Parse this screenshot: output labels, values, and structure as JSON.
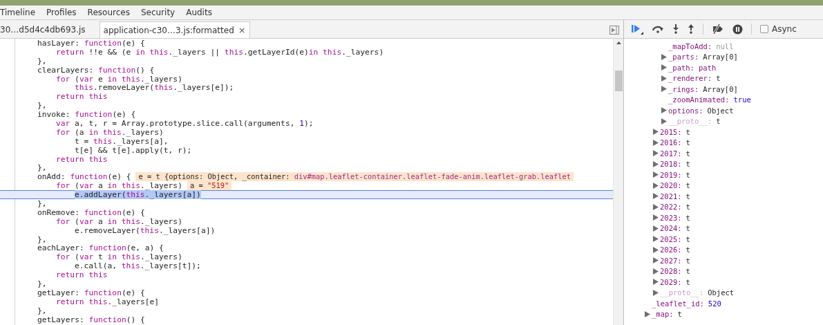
{
  "nav_tabs": [
    {
      "label": "Timeline",
      "selected": false
    },
    {
      "label": "Profiles",
      "selected": false
    },
    {
      "label": "Resources",
      "selected": false
    },
    {
      "label": "Security",
      "selected": false
    },
    {
      "label": "Audits",
      "selected": false
    }
  ],
  "file_tabs": [
    {
      "label": "30…d5d4c4db693.js",
      "selected": false
    },
    {
      "label": "application-c30…3.js:formatted",
      "selected": true,
      "close": "×"
    }
  ],
  "async": {
    "label": "Async",
    "checked": false
  },
  "code_lines": [
    {
      "tokens": [
        {
          "text": "hasLayer: ",
          "kind": "plain"
        },
        {
          "text": "function",
          "kind": "keyword"
        },
        {
          "text": "(e) {",
          "kind": "plain"
        }
      ],
      "children": [
        {
          "tokens": [
            {
              "text": "return",
              "kind": "keyword"
            },
            {
              "text": " !!e && (e ",
              "kind": "plain"
            },
            {
              "text": "in",
              "kind": "keyword"
            },
            {
              "text": " this",
              "kind": "keyword"
            },
            {
              "text": "._layers || ",
              "kind": "plain"
            },
            {
              "text": "this",
              "kind": "keyword"
            },
            {
              "text": ".getLayerId(e)",
              "kind": "plain"
            },
            {
              "text": "in",
              "kind": "keyword"
            },
            {
              "text": " this",
              "kind": "keyword"
            },
            {
              "text": "._layers)",
              "kind": "plain"
            }
          ]
        }
      ]
    },
    {
      "tokens": [
        {
          "text": "},",
          "kind": "plain"
        }
      ]
    },
    {
      "tokens": [
        {
          "text": "clearLayers: ",
          "kind": "plain"
        },
        {
          "text": "function",
          "kind": "keyword"
        },
        {
          "text": "() {",
          "kind": "plain"
        }
      ],
      "children": [
        {
          "tokens": [
            {
              "text": "for",
              "kind": "keyword"
            },
            {
              "text": " (",
              "kind": "plain"
            },
            {
              "text": "var",
              "kind": "keyword"
            },
            {
              "text": " e ",
              "kind": "plain"
            },
            {
              "text": "in",
              "kind": "keyword"
            },
            {
              "text": " this",
              "kind": "keyword"
            },
            {
              "text": "._layers)",
              "kind": "plain"
            }
          ],
          "children": [
            {
              "tokens": [
                {
                  "text": "this",
                  "kind": "keyword"
                },
                {
                  "text": ".removeLayer(",
                  "kind": "plain"
                },
                {
                  "text": "this",
                  "kind": "keyword"
                },
                {
                  "text": "._layers[e]);",
                  "kind": "plain"
                }
              ]
            }
          ]
        },
        {
          "tokens": [
            {
              "text": "return this",
              "kind": "keyword"
            }
          ]
        }
      ]
    },
    {
      "tokens": [
        {
          "text": "},",
          "kind": "plain"
        }
      ]
    },
    {
      "tokens": [
        {
          "text": "invoke: ",
          "kind": "plain"
        },
        {
          "text": "function",
          "kind": "keyword"
        },
        {
          "text": "(e) {",
          "kind": "plain"
        }
      ],
      "children": [
        {
          "tokens": [
            {
              "text": "var",
              "kind": "keyword"
            },
            {
              "text": " a, t, r = Array.prototype.slice.call(arguments, ",
              "kind": "plain"
            },
            {
              "text": "1",
              "kind": "number"
            },
            {
              "text": ");",
              "kind": "plain"
            }
          ]
        },
        {
          "tokens": [
            {
              "text": "for",
              "kind": "keyword"
            },
            {
              "text": " (a ",
              "kind": "plain"
            },
            {
              "text": "in",
              "kind": "keyword"
            },
            {
              "text": " this",
              "kind": "keyword"
            },
            {
              "text": "._layers)",
              "kind": "plain"
            }
          ],
          "children": [
            {
              "tokens": [
                {
                  "text": "t = ",
                  "kind": "plain"
                },
                {
                  "text": "this",
                  "kind": "keyword"
                },
                {
                  "text": "._layers[a],",
                  "kind": "plain"
                }
              ]
            },
            {
              "tokens": [
                {
                  "text": "t[e] && t[e].apply(t, r);",
                  "kind": "plain"
                }
              ]
            }
          ]
        },
        {
          "tokens": [
            {
              "text": "return this",
              "kind": "keyword"
            }
          ]
        }
      ]
    },
    {
      "tokens": [
        {
          "text": "},",
          "kind": "plain"
        }
      ]
    },
    {
      "tokens": [
        {
          "text": "onAdd: ",
          "kind": "plain"
        },
        {
          "text": "function",
          "kind": "keyword"
        },
        {
          "text": "(e) {",
          "kind": "plain"
        }
      ],
      "inline_value": [
        {
          "text": "e = t {options: Object, _container: ",
          "kind": "plain"
        },
        {
          "text": "div#map.leaflet-container.leaflet-fade-anim.leaflet-grab.leaflet",
          "kind": "node"
        }
      ],
      "children": [
        {
          "tokens": [
            {
              "text": "for",
              "kind": "keyword"
            },
            {
              "text": " (",
              "kind": "plain"
            },
            {
              "text": "var",
              "kind": "keyword"
            },
            {
              "text": " a ",
              "kind": "plain"
            },
            {
              "text": "in",
              "kind": "keyword"
            },
            {
              "text": " this",
              "kind": "keyword"
            },
            {
              "text": "._layers)",
              "kind": "plain"
            }
          ],
          "inline_value": [
            {
              "text": "a = ",
              "kind": "plain"
            },
            {
              "text": "\"519\"",
              "kind": "string"
            }
          ],
          "children": [
            {
              "tokens": [
                {
                  "text": "e.addLayer(",
                  "kind": "plain"
                },
                {
                  "text": "this",
                  "kind": "keyword"
                },
                {
                  "text": "._layers[a])",
                  "kind": "plain"
                }
              ],
              "current": true
            }
          ]
        }
      ]
    },
    {
      "tokens": [
        {
          "text": "},",
          "kind": "plain"
        }
      ]
    },
    {
      "tokens": [
        {
          "text": "onRemove: ",
          "kind": "plain"
        },
        {
          "text": "function",
          "kind": "keyword"
        },
        {
          "text": "(e) {",
          "kind": "plain"
        }
      ],
      "children": [
        {
          "tokens": [
            {
              "text": "for",
              "kind": "keyword"
            },
            {
              "text": " (",
              "kind": "plain"
            },
            {
              "text": "var",
              "kind": "keyword"
            },
            {
              "text": " a ",
              "kind": "plain"
            },
            {
              "text": "in",
              "kind": "keyword"
            },
            {
              "text": " this",
              "kind": "keyword"
            },
            {
              "text": "._layers)",
              "kind": "plain"
            }
          ],
          "children": [
            {
              "tokens": [
                {
                  "text": "e.removeLayer(",
                  "kind": "plain"
                },
                {
                  "text": "this",
                  "kind": "keyword"
                },
                {
                  "text": "._layers[a])",
                  "kind": "plain"
                }
              ]
            }
          ]
        }
      ]
    },
    {
      "tokens": [
        {
          "text": "},",
          "kind": "plain"
        }
      ]
    },
    {
      "tokens": [
        {
          "text": "eachLayer: ",
          "kind": "plain"
        },
        {
          "text": "function",
          "kind": "keyword"
        },
        {
          "text": "(e, a) {",
          "kind": "plain"
        }
      ],
      "children": [
        {
          "tokens": [
            {
              "text": "for",
              "kind": "keyword"
            },
            {
              "text": " (",
              "kind": "plain"
            },
            {
              "text": "var",
              "kind": "keyword"
            },
            {
              "text": " t ",
              "kind": "plain"
            },
            {
              "text": "in",
              "kind": "keyword"
            },
            {
              "text": " this",
              "kind": "keyword"
            },
            {
              "text": "._layers)",
              "kind": "plain"
            }
          ],
          "children": [
            {
              "tokens": [
                {
                  "text": "e.call(a, ",
                  "kind": "plain"
                },
                {
                  "text": "this",
                  "kind": "keyword"
                },
                {
                  "text": "._layers[t]);",
                  "kind": "plain"
                }
              ]
            }
          ]
        },
        {
          "tokens": [
            {
              "text": "return this",
              "kind": "keyword"
            }
          ]
        }
      ]
    },
    {
      "tokens": [
        {
          "text": "},",
          "kind": "plain"
        }
      ]
    },
    {
      "tokens": [
        {
          "text": "getLayer: ",
          "kind": "plain"
        },
        {
          "text": "function",
          "kind": "keyword"
        },
        {
          "text": "(e) {",
          "kind": "plain"
        }
      ],
      "children": [
        {
          "tokens": [
            {
              "text": "return this",
              "kind": "keyword"
            },
            {
              "text": "._layers[e]",
              "kind": "plain"
            }
          ]
        }
      ]
    },
    {
      "tokens": [
        {
          "text": "},",
          "kind": "plain"
        }
      ]
    },
    {
      "tokens": [
        {
          "text": "getLayers: ",
          "kind": "plain"
        },
        {
          "text": "function",
          "kind": "keyword"
        },
        {
          "text": "() {",
          "kind": "plain"
        }
      ]
    }
  ],
  "scope": [
    {
      "children": [
        {
          "children": [
            {
              "name": "_mapToAdd:",
              "value": "null",
              "kind": "null",
              "expandable": false,
              "internal": false
            },
            {
              "name": "_parts:",
              "value": "Array[0]",
              "kind": "object",
              "expandable": true,
              "internal": false
            },
            {
              "name": "_path:",
              "value": "path",
              "kind": "node",
              "expandable": true,
              "internal": false
            },
            {
              "name": "_renderer:",
              "value": "t",
              "kind": "object",
              "expandable": true,
              "internal": false
            },
            {
              "name": "_rings:",
              "value": "Array[0]",
              "kind": "object",
              "expandable": true,
              "internal": false
            },
            {
              "name": "_zoomAnimated:",
              "value": "true",
              "kind": "boolean",
              "expandable": false,
              "internal": false
            },
            {
              "name": "options:",
              "value": "Object",
              "kind": "object",
              "expandable": true,
              "internal": false
            },
            {
              "name": "__proto__:",
              "value": "t",
              "kind": "object",
              "expandable": true,
              "internal": true
            }
          ]
        },
        {
          "name": "2015:",
          "value": "t",
          "kind": "object",
          "expandable": true,
          "internal": false
        },
        {
          "name": "2016:",
          "value": "t",
          "kind": "object",
          "expandable": true,
          "internal": false
        },
        {
          "name": "2017:",
          "value": "t",
          "kind": "object",
          "expandable": true,
          "internal": false
        },
        {
          "name": "2018:",
          "value": "t",
          "kind": "object",
          "expandable": true,
          "internal": false
        },
        {
          "name": "2019:",
          "value": "t",
          "kind": "object",
          "expandable": true,
          "internal": false
        },
        {
          "name": "2020:",
          "value": "t",
          "kind": "object",
          "expandable": true,
          "internal": false
        },
        {
          "name": "2021:",
          "value": "t",
          "kind": "object",
          "expandable": true,
          "internal": false
        },
        {
          "name": "2022:",
          "value": "t",
          "kind": "object",
          "expandable": true,
          "internal": false
        },
        {
          "name": "2023:",
          "value": "t",
          "kind": "object",
          "expandable": true,
          "internal": false
        },
        {
          "name": "2024:",
          "value": "t",
          "kind": "object",
          "expandable": true,
          "internal": false
        },
        {
          "name": "2025:",
          "value": "t",
          "kind": "object",
          "expandable": true,
          "internal": false
        },
        {
          "name": "2026:",
          "value": "t",
          "kind": "object",
          "expandable": true,
          "internal": false
        },
        {
          "name": "2027:",
          "value": "t",
          "kind": "object",
          "expandable": true,
          "internal": false
        },
        {
          "name": "2028:",
          "value": "t",
          "kind": "object",
          "expandable": true,
          "internal": false
        },
        {
          "name": "2029:",
          "value": "t",
          "kind": "object",
          "expandable": true,
          "internal": false
        },
        {
          "name": "__proto__:",
          "value": "Object",
          "kind": "object",
          "expandable": true,
          "internal": true
        }
      ]
    },
    {
      "name": "_leaflet_id:",
      "value": "520",
      "kind": "number",
      "expandable": false,
      "internal": false
    },
    {
      "name": "_map:",
      "value": "t",
      "kind": "object",
      "expandable": true,
      "internal": false
    }
  ]
}
